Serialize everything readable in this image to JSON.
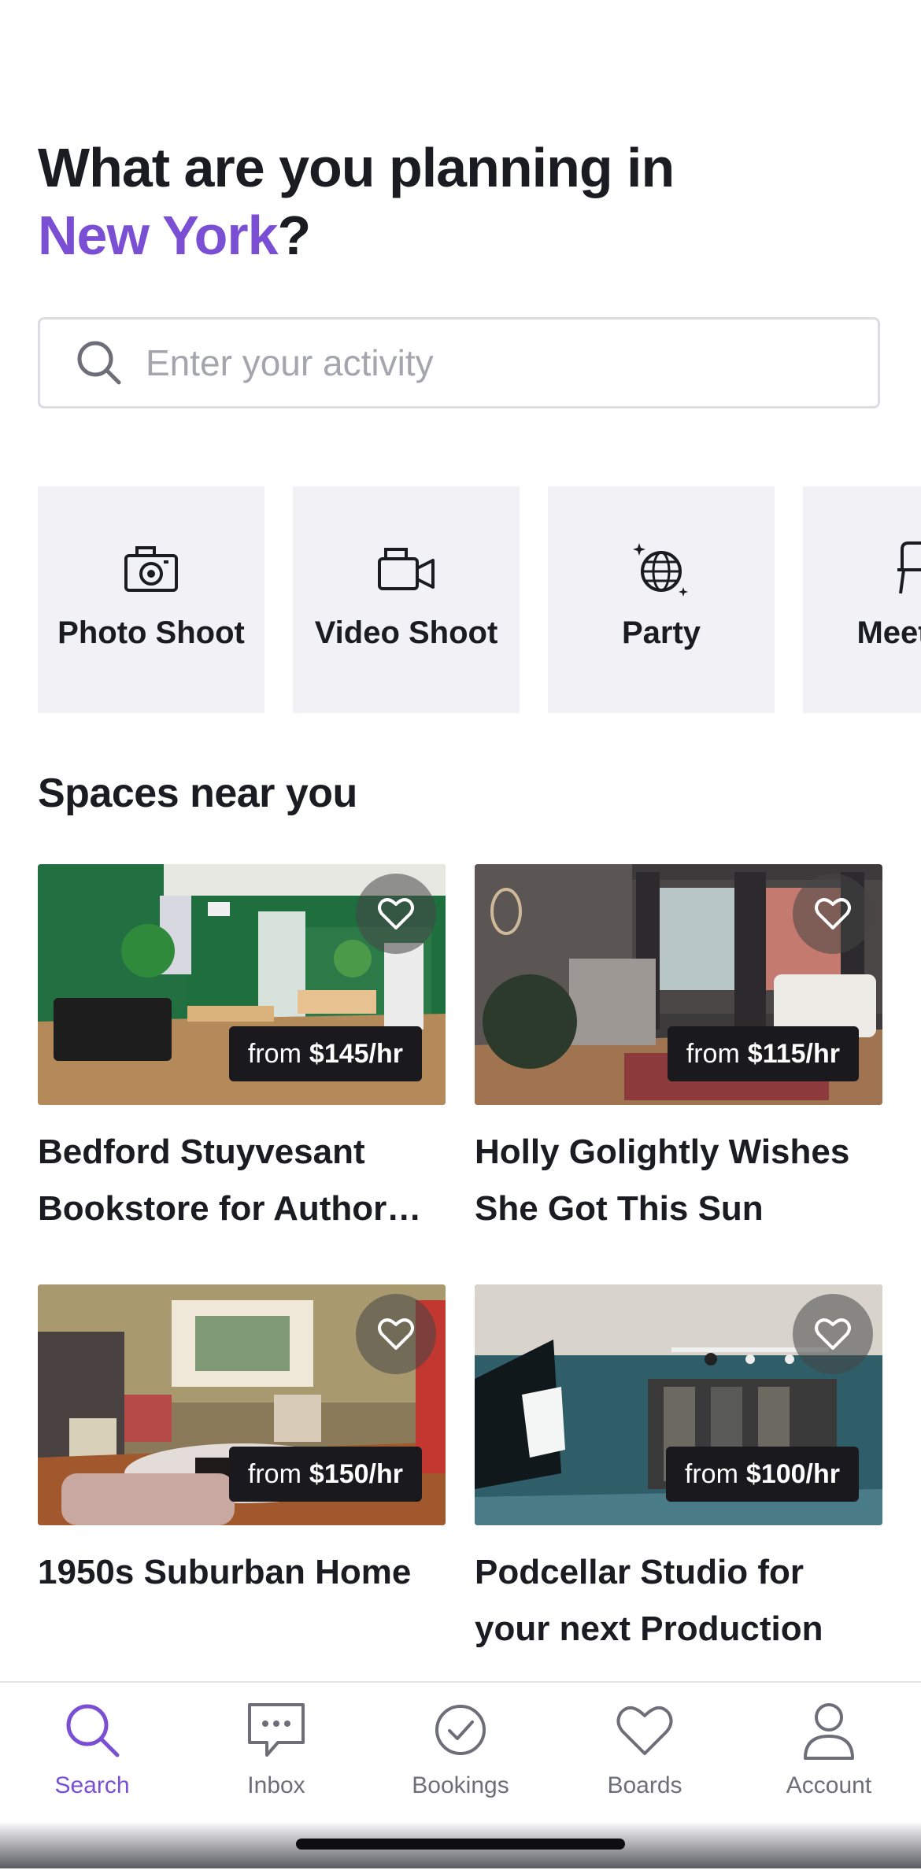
{
  "header": {
    "heading_line1": "What are you planning in",
    "heading_city": "New York",
    "heading_suffix": "?"
  },
  "search": {
    "placeholder": "Enter your activity",
    "icon": "search-icon"
  },
  "categories": [
    {
      "label": "Photo Shoot",
      "icon": "camera-icon"
    },
    {
      "label": "Video Shoot",
      "icon": "video-camera-icon"
    },
    {
      "label": "Party",
      "icon": "disco-ball-icon"
    },
    {
      "label": "Meeting",
      "icon": "chair-icon"
    }
  ],
  "spaces": {
    "title": "Spaces near you",
    "price_prefix": "from",
    "items": [
      {
        "title": "Bedford Stuyvesant Bookstore for Author Events",
        "price": "$145/hr",
        "favorite": false
      },
      {
        "title": "Holly Golightly Wishes She Got This Sun",
        "price": "$115/hr",
        "favorite": false
      },
      {
        "title": "1950s Suburban Home",
        "price": "$150/hr",
        "favorite": false
      },
      {
        "title": "Podcellar Studio for your next Production",
        "price": "$100/hr",
        "favorite": false
      }
    ]
  },
  "nav": {
    "active": "Search",
    "items": [
      {
        "label": "Search",
        "icon": "search-icon"
      },
      {
        "label": "Inbox",
        "icon": "chat-bubble-icon"
      },
      {
        "label": "Bookings",
        "icon": "check-circle-icon"
      },
      {
        "label": "Boards",
        "icon": "heart-icon"
      },
      {
        "label": "Account",
        "icon": "person-icon"
      }
    ]
  },
  "colors": {
    "accent": "#7b4fd4",
    "text": "#1b1b22",
    "tile_bg": "#f2f2f6",
    "price_tag_bg": "#1a1a1e"
  }
}
